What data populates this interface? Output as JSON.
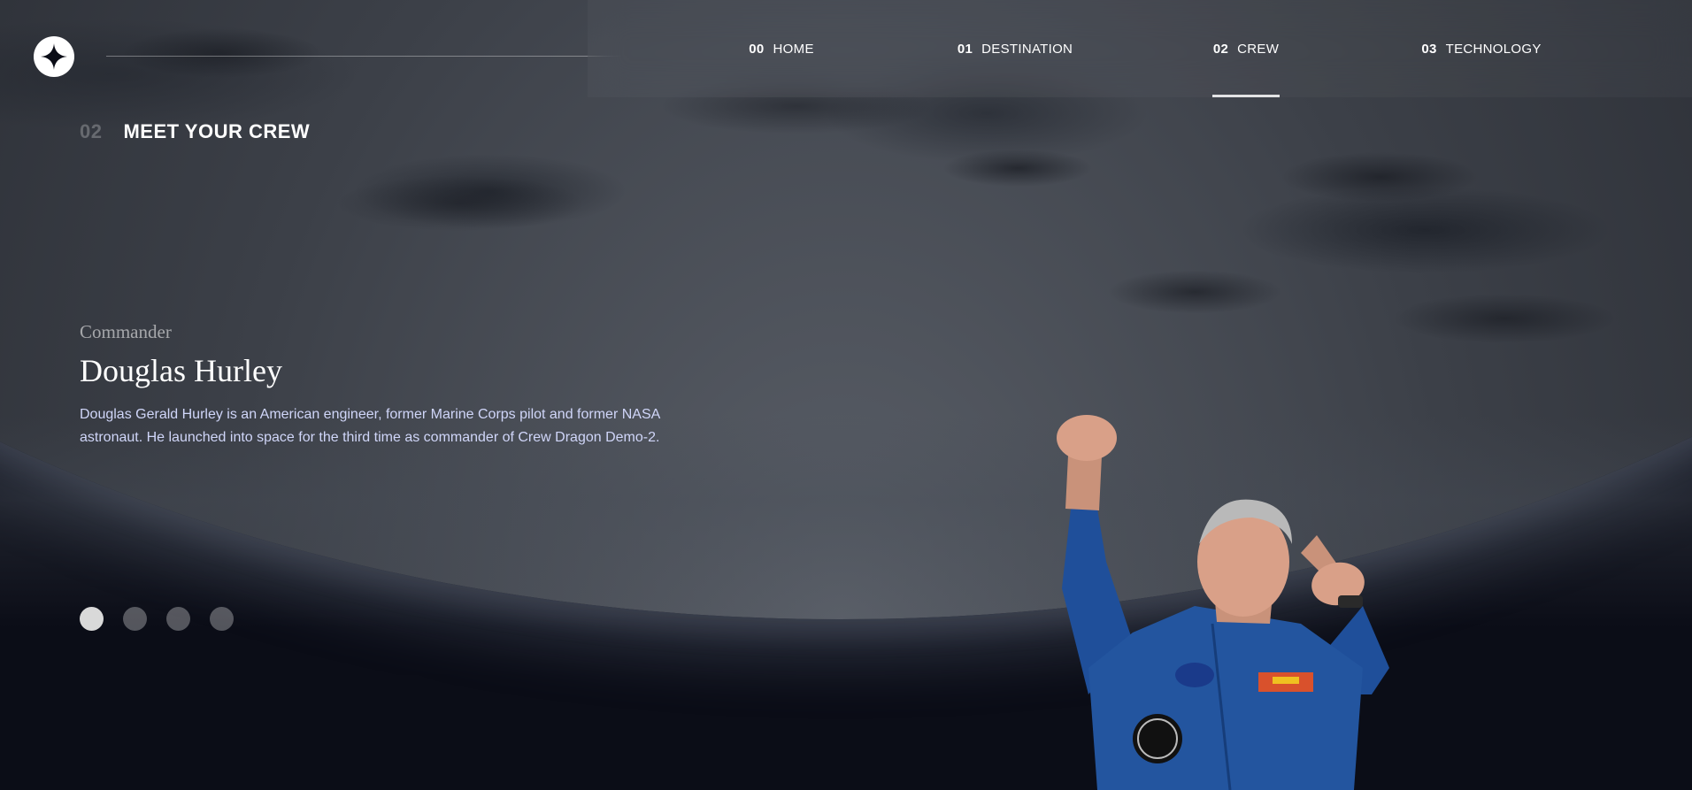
{
  "nav": {
    "items": [
      {
        "num": "00",
        "label": "HOME"
      },
      {
        "num": "01",
        "label": "DESTINATION"
      },
      {
        "num": "02",
        "label": "CREW"
      },
      {
        "num": "03",
        "label": "TECHNOLOGY"
      }
    ],
    "active_index": 2
  },
  "page_title": {
    "num": "02",
    "label": "MEET YOUR CREW"
  },
  "crew": {
    "role": "Commander",
    "name": "Douglas Hurley",
    "bio": "Douglas Gerald Hurley is an American engineer, former Marine Corps pilot and former NASA astronaut. He launched into space for the third time as commander of Crew Dragon Demo-2."
  },
  "slider": {
    "count": 4,
    "active_index": 0
  },
  "icons": {
    "logo": "star-logo-icon"
  }
}
